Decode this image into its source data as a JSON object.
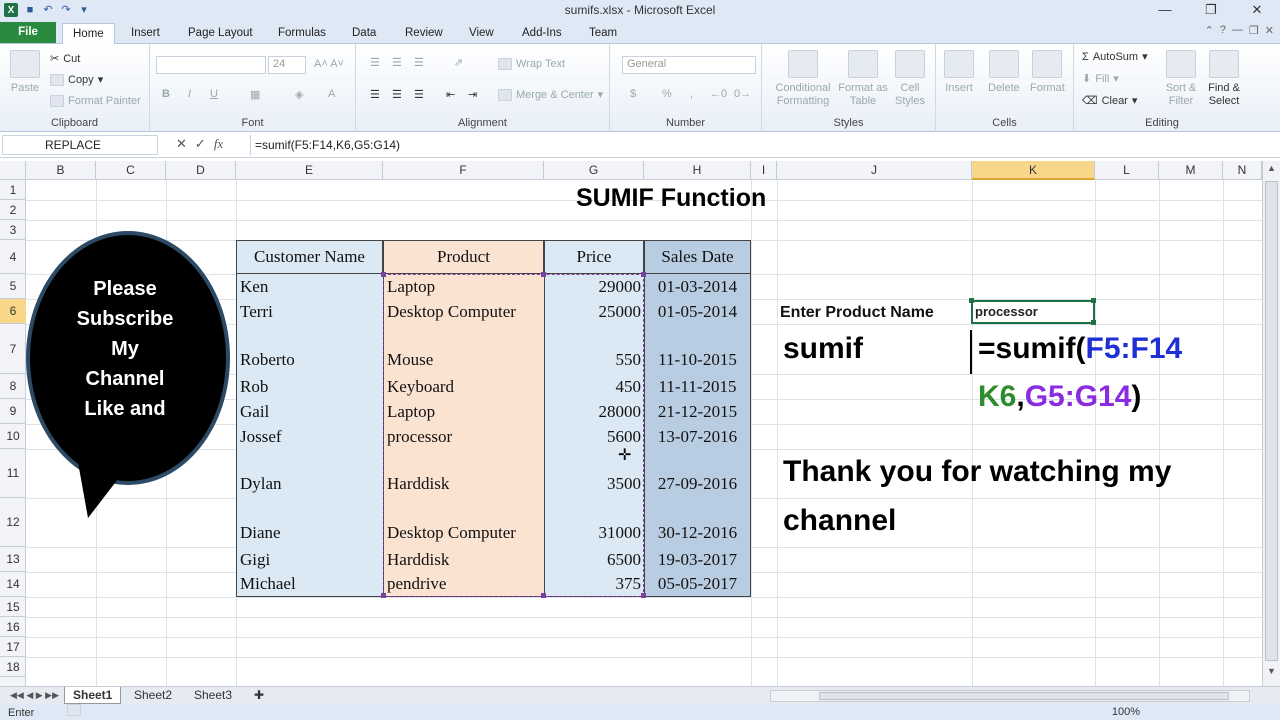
{
  "window": {
    "title": "sumifs.xlsx - Microsoft Excel",
    "app_icon": "X"
  },
  "ribbon_tabs": [
    {
      "label": "File"
    },
    {
      "label": "Home"
    },
    {
      "label": "Insert"
    },
    {
      "label": "Page Layout"
    },
    {
      "label": "Formulas"
    },
    {
      "label": "Data"
    },
    {
      "label": "Review"
    },
    {
      "label": "View"
    },
    {
      "label": "Add-Ins"
    },
    {
      "label": "Team"
    }
  ],
  "ribbon": {
    "clipboard": {
      "label": "Clipboard",
      "paste": "Paste",
      "cut": "Cut",
      "copy": "Copy",
      "format_painter": "Format Painter"
    },
    "font": {
      "label": "Font",
      "size": "24"
    },
    "alignment": {
      "label": "Alignment",
      "wrap_text": "Wrap Text",
      "merge_center": "Merge & Center"
    },
    "number": {
      "label": "Number",
      "format": "General"
    },
    "styles": {
      "label": "Styles",
      "conditional": "Conditional Formatting",
      "format_table": "Format as Table",
      "cell_styles": "Cell Styles"
    },
    "cells": {
      "label": "Cells",
      "insert": "Insert",
      "delete": "Delete",
      "format": "Format"
    },
    "editing": {
      "label": "Editing",
      "autosum": "AutoSum",
      "fill": "Fill",
      "clear": "Clear",
      "sort_filter": "Sort & Filter",
      "find_select": "Find & Select"
    }
  },
  "formula_bar": {
    "name_box": "REPLACE",
    "fx": "fx",
    "formula": "=sumif(F5:F14,K6,G5:G14)"
  },
  "columns": [
    "B",
    "C",
    "D",
    "E",
    "F",
    "G",
    "H",
    "I",
    "J",
    "K",
    "L",
    "M",
    "N"
  ],
  "rows": [
    "1",
    "2",
    "3",
    "4",
    "5",
    "6",
    "7",
    "8",
    "9",
    "10",
    "11",
    "12",
    "13",
    "14",
    "15",
    "16",
    "17",
    "18"
  ],
  "sheet": {
    "title": "SUMIF Function",
    "headers": [
      "Customer Name",
      "Product",
      "Price",
      "Sales Date"
    ],
    "data": [
      [
        "Ken",
        "Laptop",
        "29000",
        "01-03-2014"
      ],
      [
        "Terri",
        "Desktop Computer",
        "25000",
        "01-05-2014"
      ],
      [
        "Roberto",
        "Mouse",
        "550",
        "11-10-2015"
      ],
      [
        "Rob",
        "Keyboard",
        "450",
        "11-11-2015"
      ],
      [
        "Gail",
        "Laptop",
        "28000",
        "21-12-2015"
      ],
      [
        "Jossef",
        "processor",
        "5600",
        "13-07-2016"
      ],
      [
        "Dylan",
        "Harddisk",
        "3500",
        "27-09-2016"
      ],
      [
        "Diane",
        "Desktop Computer",
        "31000",
        "30-12-2016"
      ],
      [
        "Gigi",
        "Harddisk",
        "6500",
        "19-03-2017"
      ],
      [
        "Michael",
        "pendrive",
        "375",
        "05-05-2017"
      ]
    ],
    "enter_product_label": "Enter Product  Name",
    "k6_value": "processor",
    "sumif_label": "sumif",
    "formula_parts": {
      "p1": "=sumif(",
      "p2": "F5:F14",
      ",p3": ",",
      "p4": "K6",
      "p5": ",",
      "p6": "G5:G14",
      "p7": ")"
    },
    "thanks_line1": "Thank you for watching my",
    "thanks_line2": "channel"
  },
  "callout": {
    "lines": [
      "Please",
      "Subscribe",
      "My",
      "Channel",
      "Like and"
    ]
  },
  "sheet_tabs": [
    "Sheet1",
    "Sheet2",
    "Sheet3"
  ],
  "status": {
    "mode": "Enter",
    "zoom": "100%"
  },
  "colors": {
    "blue_fill": "#dbe9f4",
    "orange_fill": "#fbe3d2",
    "purple_fill": "#b9cde2",
    "formula_blue": "#1f2fd6",
    "formula_green": "#2e8b2e",
    "formula_purple": "#8a2be2"
  }
}
